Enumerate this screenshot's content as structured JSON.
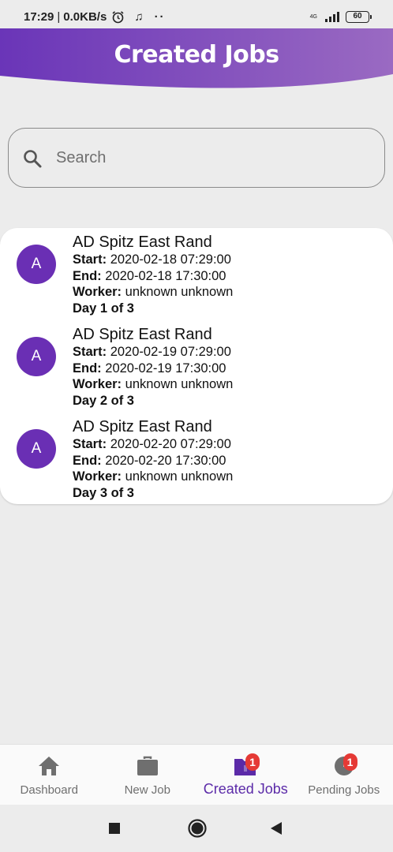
{
  "status_bar": {
    "time": "17:29",
    "speed": "0.0KB/s",
    "network": "4G",
    "battery": "60"
  },
  "header": {
    "title": "Created Jobs"
  },
  "colors": {
    "accent": "#5b2aa8",
    "header_start": "#6a35b8",
    "header_end": "#9a6ac2",
    "avatar": "#6a2fb4",
    "badge": "#e53935"
  },
  "search": {
    "placeholder": "Search",
    "value": ""
  },
  "jobs": [
    {
      "avatar": "A",
      "title": "AD Spitz East Rand",
      "start_label": "Start:",
      "start": "2020-02-18 07:29:00",
      "end_label": "End:",
      "end": "2020-02-18 17:30:00",
      "worker_label": "Worker:",
      "worker": "unknown unknown",
      "day": "Day 1 of 3"
    },
    {
      "avatar": "A",
      "title": "AD Spitz East Rand",
      "start_label": "Start:",
      "start": "2020-02-19 07:29:00",
      "end_label": "End:",
      "end": "2020-02-19 17:30:00",
      "worker_label": "Worker:",
      "worker": "unknown unknown",
      "day": "Day 2 of 3"
    },
    {
      "avatar": "A",
      "title": "AD Spitz East Rand",
      "start_label": "Start:",
      "start": "2020-02-20 07:29:00",
      "end_label": "End:",
      "end": "2020-02-20 17:30:00",
      "worker_label": "Worker:",
      "worker": "unknown unknown",
      "day": "Day 3 of 3"
    }
  ],
  "bottom_nav": {
    "items": [
      {
        "label": "Dashboard",
        "icon": "home-icon"
      },
      {
        "label": "New Job",
        "icon": "briefcase-icon"
      },
      {
        "label": "Created Jobs",
        "icon": "folder-icon",
        "badge": "1",
        "active": true
      },
      {
        "label": "Pending Jobs",
        "icon": "clock-icon",
        "badge": "1"
      }
    ]
  },
  "system_nav": {
    "icons": [
      "recent-apps-icon",
      "home-circle-icon",
      "back-icon"
    ]
  }
}
